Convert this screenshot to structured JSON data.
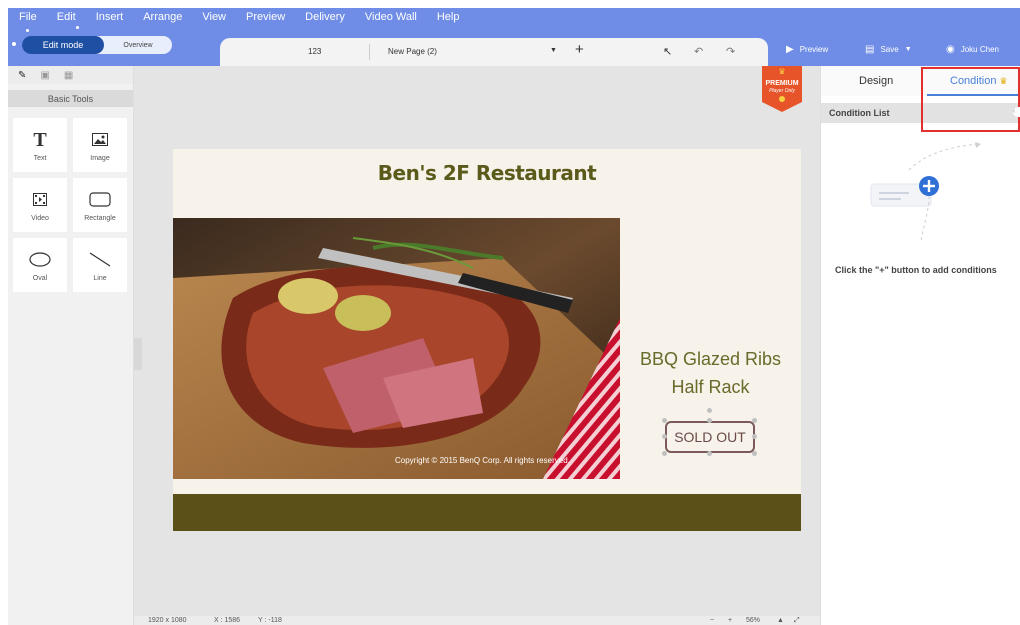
{
  "menu": [
    "File",
    "Edit",
    "Insert",
    "Arrange",
    "View",
    "Preview",
    "Delivery",
    "Video Wall",
    "Help"
  ],
  "mode": {
    "active": "Edit mode",
    "inactive": "Overview"
  },
  "pagebar": {
    "page_number": "123",
    "page_name": "New Page (2)"
  },
  "header_actions": {
    "preview": "Preview",
    "save": "Save",
    "user": "Joku Chen"
  },
  "left_panel": {
    "section": "Basic Tools",
    "tools": [
      {
        "label": "Text",
        "icon": "text-icon"
      },
      {
        "label": "Image",
        "icon": "image-icon"
      },
      {
        "label": "Video",
        "icon": "video-icon"
      },
      {
        "label": "Rectangle",
        "icon": "rectangle-icon"
      },
      {
        "label": "Oval",
        "icon": "oval-icon"
      },
      {
        "label": "Line",
        "icon": "line-icon"
      }
    ]
  },
  "slide": {
    "title": "Ben's 2F Restaurant",
    "item_line1": "BBQ Glazed Ribs",
    "item_line2": "Half Rack",
    "badge": "SOLD OUT",
    "copyright": "Copyright © 2015 BenQ Corp. All rights reserved.",
    "colors": {
      "title": "#5a5a1a",
      "footer": "#5a5018",
      "background": "#f7f2ea"
    }
  },
  "premium_badge": {
    "line1": "PREMIUM",
    "line2": "Player Only"
  },
  "status_bar": {
    "resolution": "1920 x 1080",
    "x": "X : 1586",
    "y": "Y : -118",
    "zoom": "56%"
  },
  "right_panel": {
    "tabs": {
      "design": "Design",
      "condition": "Condition"
    },
    "list_header": "Condition List",
    "hint": "Click the \"+\" button to add conditions"
  },
  "accent_color": "#4a7fd8",
  "header_color": "#6f8de6"
}
